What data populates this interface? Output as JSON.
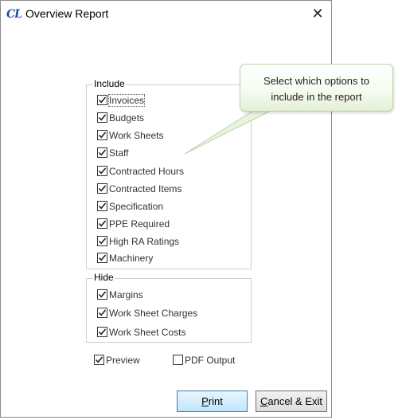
{
  "window": {
    "icon_text": "CL",
    "title": "Overview Report",
    "close_symbol": "✕"
  },
  "include": {
    "label": "Include",
    "options": [
      {
        "label": "Invoices",
        "checked": true
      },
      {
        "label": "Budgets",
        "checked": true
      },
      {
        "label": "Work Sheets",
        "checked": true
      },
      {
        "label": "Staff",
        "checked": true
      },
      {
        "label": "Contracted Hours",
        "checked": true
      },
      {
        "label": "Contracted Items",
        "checked": true
      },
      {
        "label": "Specification",
        "checked": true
      },
      {
        "label": "PPE Required",
        "checked": true
      },
      {
        "label": "High RA Ratings",
        "checked": true
      },
      {
        "label": "Machinery",
        "checked": true
      }
    ]
  },
  "hide": {
    "label": "Hide",
    "options": [
      {
        "label": "Margins",
        "checked": true
      },
      {
        "label": "Work Sheet Charges",
        "checked": true
      },
      {
        "label": "Work Sheet Costs",
        "checked": true
      }
    ]
  },
  "output": {
    "preview": {
      "label": "Preview",
      "checked": true
    },
    "pdf": {
      "label": "PDF Output",
      "checked": false
    }
  },
  "buttons": {
    "print_hotkey": "P",
    "print_rest": "rint",
    "cancel_hotkey": "C",
    "cancel_rest": "ancel & Exit"
  },
  "tooltip": {
    "line1": "Select which options to",
    "line2": "include in the report"
  },
  "colors": {
    "check": "#222222",
    "tooltip_border": "#b9d3a6",
    "print_border": "#3c7fb1"
  }
}
